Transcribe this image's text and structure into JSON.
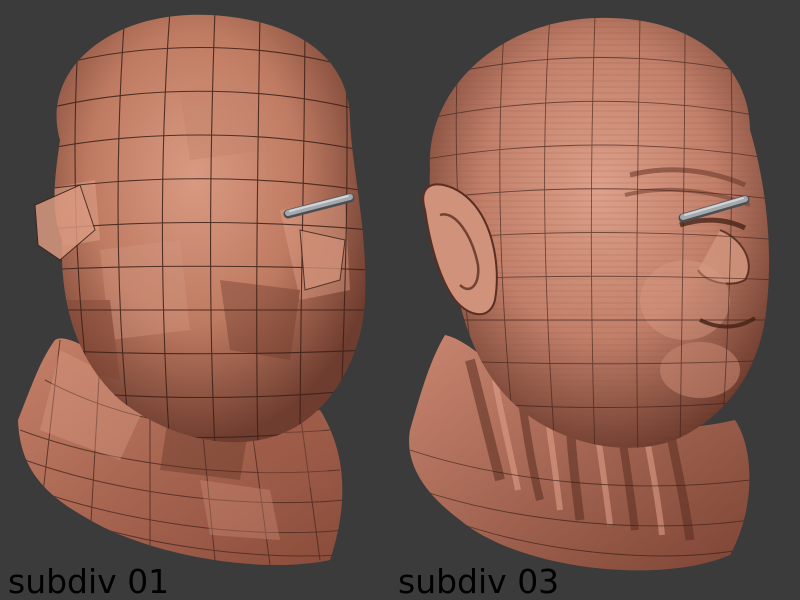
{
  "captions": {
    "left": "subdiv 01",
    "right": "subdiv 03"
  },
  "colors": {
    "background": "#3b3b3b",
    "clay_light": "#c98a73",
    "clay_mid": "#b06e58",
    "clay_dark": "#7a4536",
    "wire": "#3a2018",
    "pin": "#8e9296"
  },
  "icons": {
    "left_model": "low-poly-head-mesh",
    "right_model": "sculpted-head-mesh",
    "pin": "gray-pin-marker"
  }
}
